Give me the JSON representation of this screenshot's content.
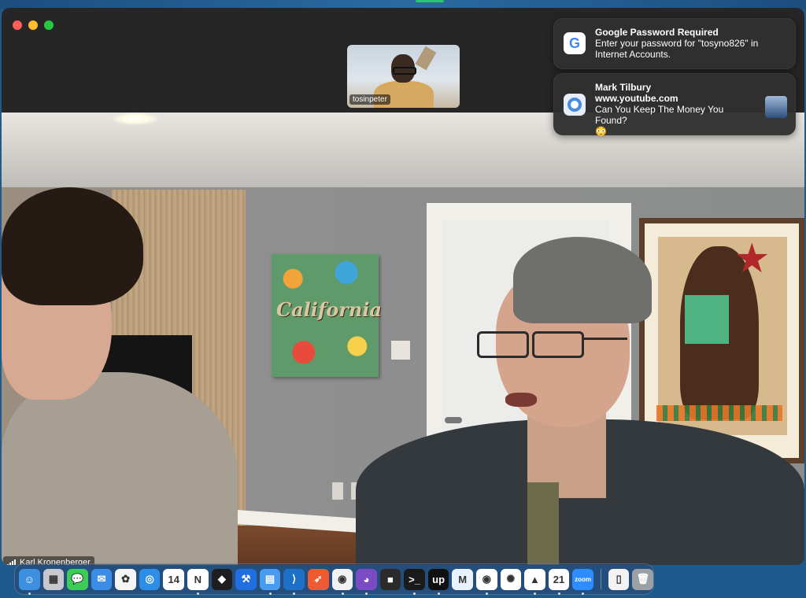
{
  "window": {
    "title": ""
  },
  "participants": {
    "thumbnail_name": "tosinpeter",
    "main_name": "Karl Kronenberger"
  },
  "video": {
    "poster_text": "California"
  },
  "notifications": [
    {
      "app": "google-password",
      "icon": "google-icon",
      "title": "Google Password Required",
      "body": "Enter your password for \"tosyno826\" in Internet Accounts."
    },
    {
      "app": "chrome",
      "icon": "chrome-icon",
      "title": "Mark Tilbury",
      "subtitle": "www.youtube.com",
      "body": "Can You Keep The Money You Found?",
      "emoji": "😳"
    }
  ],
  "dock": {
    "items": [
      {
        "name": "finder-icon",
        "glyph": "☺",
        "color": "#3d8fe0",
        "running": true
      },
      {
        "name": "launchpad-icon",
        "glyph": "▦",
        "color": "#c7c7cf",
        "running": false
      },
      {
        "name": "messages-icon",
        "glyph": "💬",
        "color": "#3ccc5a",
        "running": false
      },
      {
        "name": "mail-icon",
        "glyph": "✉",
        "color": "#3c8de8",
        "running": false
      },
      {
        "name": "photos-icon",
        "glyph": "✿",
        "color": "#f5f5f5",
        "running": false
      },
      {
        "name": "safari-icon",
        "glyph": "◎",
        "color": "#2d8ee8",
        "running": false
      },
      {
        "name": "calendar-icon",
        "glyph": "14",
        "color": "#ffffff",
        "running": false
      },
      {
        "name": "notion-icon",
        "glyph": "N",
        "color": "#ffffff",
        "running": true
      },
      {
        "name": "figma-icon",
        "glyph": "◆",
        "color": "#1e1e1e",
        "running": false
      },
      {
        "name": "xcode-icon",
        "glyph": "⚒",
        "color": "#1f6fe0",
        "running": false
      },
      {
        "name": "files-icon",
        "glyph": "▤",
        "color": "#4a9bf0",
        "running": true
      },
      {
        "name": "vscode-icon",
        "glyph": "⟩",
        "color": "#1e6fc8",
        "running": true
      },
      {
        "name": "swift-icon",
        "glyph": "➶",
        "color": "#f05a30",
        "running": false
      },
      {
        "name": "chrome-icon",
        "glyph": "◉",
        "color": "#f2f2f2",
        "running": true
      },
      {
        "name": "github-icon",
        "glyph": "◕",
        "color": "#7b4bc4",
        "running": true
      },
      {
        "name": "box-icon",
        "glyph": "■",
        "color": "#2b2b2b",
        "running": false
      },
      {
        "name": "terminal-icon",
        "glyph": ">_",
        "color": "#1a1a1a",
        "running": true
      },
      {
        "name": "upwork-icon",
        "glyph": "up",
        "color": "#111111",
        "running": true
      },
      {
        "name": "mail-app-icon",
        "glyph": "M",
        "color": "#e8f2ff",
        "running": false
      },
      {
        "name": "chrome-profile-icon",
        "glyph": "◉",
        "color": "#ffffff",
        "running": true
      },
      {
        "name": "chatgpt-icon",
        "glyph": "✺",
        "color": "#ffffff",
        "running": false
      },
      {
        "name": "analytics-icon",
        "glyph": "▲",
        "color": "#ffffff",
        "running": true
      },
      {
        "name": "chrome-badge-icon",
        "glyph": "21",
        "color": "#ffffff",
        "running": true
      },
      {
        "name": "zoom-icon",
        "glyph": "zoom",
        "color": "#2d8cff",
        "running": true
      }
    ],
    "trailing": [
      {
        "name": "document-icon",
        "glyph": "▯",
        "color": "#f3f3f3",
        "running": false
      },
      {
        "name": "trash-icon",
        "glyph": "🗑",
        "color": "#9aa0a6",
        "running": false
      }
    ]
  },
  "colors": {
    "accent": "#2d8cff",
    "close": "#ff5f57",
    "minimize": "#febc2e",
    "maximize": "#28c840"
  }
}
